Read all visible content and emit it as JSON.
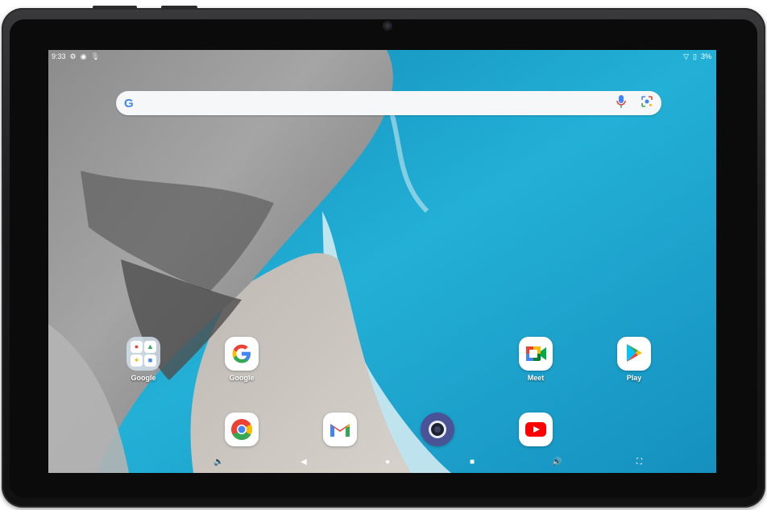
{
  "status_bar": {
    "time": "9:33",
    "battery": "3%",
    "icons": [
      "gear-icon",
      "record-icon",
      "mic-icon",
      "wifi-icon",
      "battery-icon"
    ]
  },
  "search": {
    "logo": "G",
    "icons": [
      "mic-icon",
      "lens-icon"
    ]
  },
  "home_apps": [
    {
      "label": "Google",
      "icon": "google-folder-icon"
    },
    {
      "label": "Google",
      "icon": "google-app-icon"
    },
    {
      "label": "Meet",
      "icon": "meet-icon"
    },
    {
      "label": "Play",
      "icon": "play-store-icon"
    }
  ],
  "dock": [
    {
      "icon": "chrome-icon"
    },
    {
      "icon": "gmail-icon"
    },
    {
      "icon": "camera-icon"
    },
    {
      "icon": "youtube-icon"
    }
  ],
  "nav_bar": {
    "icons": [
      "volume-down-icon",
      "back-icon",
      "home-icon",
      "recents-icon",
      "volume-up-icon",
      "screenshot-icon"
    ]
  },
  "colors": {
    "sea": "#1da1c9",
    "google_blue": "#4285f4",
    "google_red": "#ea4335",
    "google_yellow": "#fbbc05",
    "google_green": "#34a853"
  }
}
